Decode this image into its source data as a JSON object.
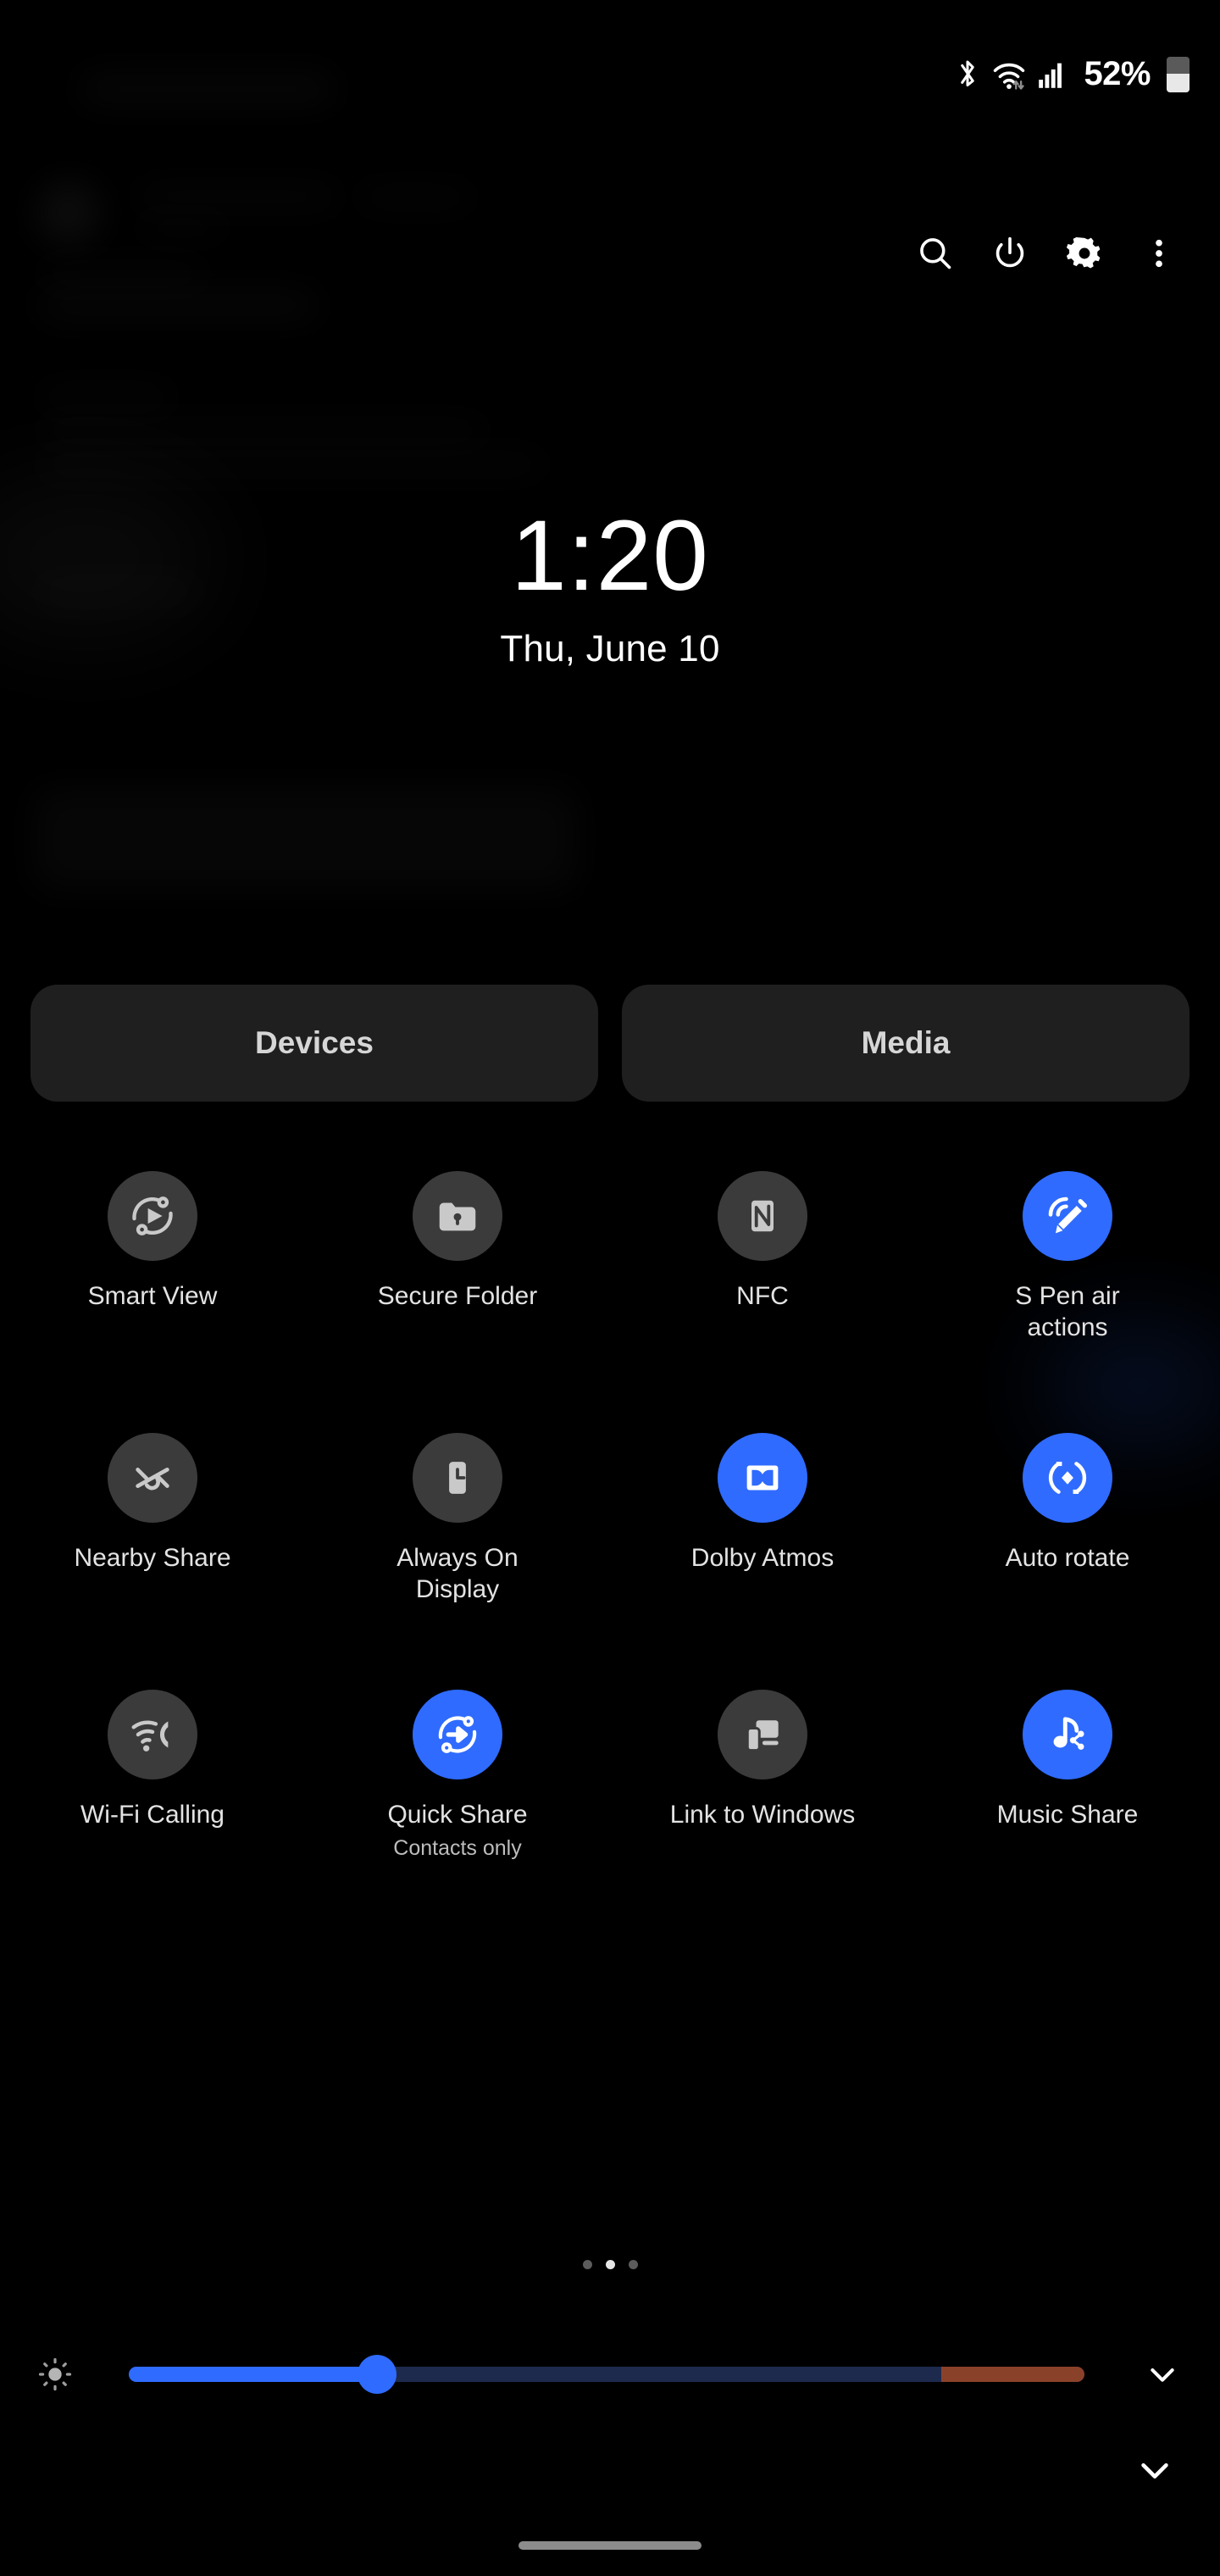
{
  "status_bar": {
    "bluetooth_icon": "bluetooth-icon",
    "wifi_icon": "wifi-icon",
    "signal_icon": "cellular-signal-icon",
    "battery_percent": "52%",
    "battery_icon": "battery-icon",
    "battery_level": 52
  },
  "toolbar": {
    "search": "search-icon",
    "power": "power-icon",
    "settings": "gear-icon",
    "more": "more-options-icon"
  },
  "clock": {
    "time": "1:20",
    "date": "Thu, June 10"
  },
  "shortcuts": {
    "devices_label": "Devices",
    "media_label": "Media"
  },
  "tiles": [
    {
      "label": "Smart View",
      "sub": "",
      "active": false,
      "icon": "smart-view-icon"
    },
    {
      "label": "Secure Folder",
      "sub": "",
      "active": false,
      "icon": "secure-folder-icon"
    },
    {
      "label": "NFC",
      "sub": "",
      "active": false,
      "icon": "nfc-icon"
    },
    {
      "label": "S Pen air actions",
      "sub": "",
      "active": true,
      "icon": "s-pen-icon"
    },
    {
      "label": "Nearby Share",
      "sub": "",
      "active": false,
      "icon": "nearby-share-icon"
    },
    {
      "label": "Always On Display",
      "sub": "",
      "active": false,
      "icon": "always-on-display-icon"
    },
    {
      "label": "Dolby Atmos",
      "sub": "",
      "active": true,
      "icon": "dolby-atmos-icon"
    },
    {
      "label": "Auto rotate",
      "sub": "",
      "active": true,
      "icon": "auto-rotate-icon"
    },
    {
      "label": "Wi-Fi Calling",
      "sub": "",
      "active": false,
      "icon": "wifi-calling-icon"
    },
    {
      "label": "Quick Share",
      "sub": "Contacts only",
      "active": true,
      "icon": "quick-share-icon"
    },
    {
      "label": "Link to Windows",
      "sub": "",
      "active": false,
      "icon": "link-to-windows-icon"
    },
    {
      "label": "Music Share",
      "sub": "",
      "active": true,
      "icon": "music-share-icon"
    }
  ],
  "pages": {
    "count": 3,
    "active_index": 1
  },
  "brightness": {
    "icon": "brightness-icon",
    "value_percent": 26,
    "extra_zone_percent": 15,
    "expand_icon": "chevron-down-icon"
  },
  "collapse": {
    "icon": "chevron-down-icon"
  },
  "navigation": {
    "pill": "home-gesture-pill"
  },
  "colors": {
    "accent": "#2f6bff",
    "tile_off": "#3b3b3b",
    "button_bg": "#1f1f1f",
    "extra_brightness": "#8a412a",
    "background": "#000000"
  }
}
